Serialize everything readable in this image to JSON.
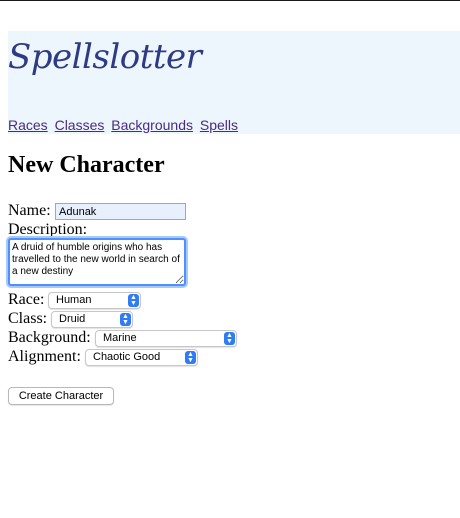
{
  "brand": "Spellslotter",
  "nav": [
    "Races",
    "Classes",
    "Backgrounds",
    "Spells"
  ],
  "page_title": "New Character",
  "form": {
    "name_label": "Name:",
    "name_value": "Adunak",
    "description_label": "Description:",
    "description_value": "A druid of humble origins who has travelled to the new world in search of a new destiny",
    "race_label": "Race:",
    "race_value": "Human",
    "class_label": "Class:",
    "class_value": "Druid",
    "background_label": "Background:",
    "background_value": "Marine",
    "alignment_label": "Alignment:",
    "alignment_value": "Chaotic Good",
    "submit_label": "Create Character"
  },
  "colors": {
    "header_bg": "#eef6fd",
    "brand": "#2e3a82",
    "link": "#4a2a84",
    "select_accent": "#2f7cf6"
  }
}
